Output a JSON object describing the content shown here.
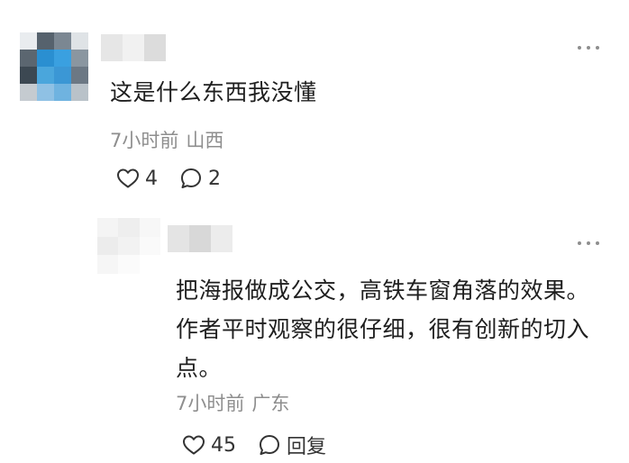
{
  "comments": [
    {
      "text": "这是什么东西我没懂",
      "time": "7小时前",
      "region": "山西",
      "likes": "4",
      "replies": "2",
      "more_icon": "more-dots-icon"
    },
    {
      "text": "把海报做成公交，高铁车窗角落的效果。作者平时观察的很仔细，很有创新的切入点。",
      "time": "7小时前",
      "region": "广东",
      "likes": "45",
      "reply_label": "回复",
      "more_icon": "more-dots-icon"
    }
  ],
  "colors": {
    "text": "#1f1f1f",
    "meta": "#8e8e8e",
    "icon": "#333333"
  }
}
